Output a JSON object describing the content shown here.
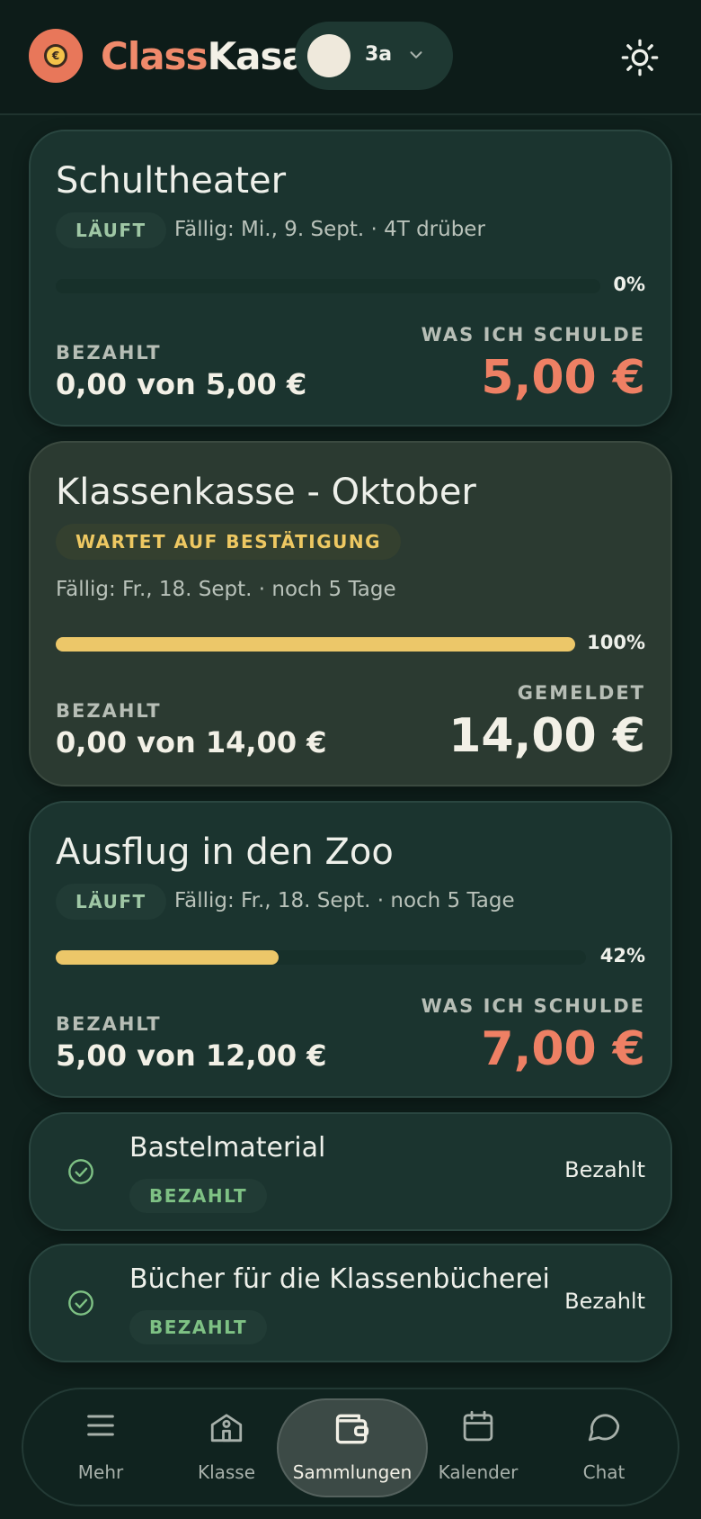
{
  "header": {
    "brand_part1": "Class",
    "brand_part2": "Kasa",
    "class_name": "3a"
  },
  "collections": [
    {
      "title": "Schultheater",
      "status": "LÄUFT",
      "due": "Fällig: Mi., 9. Sept. · 4T drüber",
      "progress_percent": 0,
      "progress_label": "0%",
      "paid_label": "BEZAHLT",
      "paid_value": "0,00 von 5,00 €",
      "amount_label": "WAS ICH SCHULDE",
      "amount_value": "5,00 €"
    },
    {
      "title": "Klassenkasse - Oktober",
      "status": "WARTET AUF BESTÄTIGUNG",
      "due": "Fällig: Fr., 18. Sept. · noch 5 Tage",
      "progress_percent": 100,
      "progress_label": "100%",
      "paid_label": "BEZAHLT",
      "paid_value": "0,00 von 14,00 €",
      "amount_label": "GEMELDET",
      "amount_value": "14,00 €"
    },
    {
      "title": "Ausflug in den Zoo",
      "status": "LÄUFT",
      "due": "Fällig: Fr., 18. Sept. · noch 5 Tage",
      "progress_percent": 42,
      "progress_label": "42%",
      "paid_label": "BEZAHLT",
      "paid_value": "5,00 von 12,00 €",
      "amount_label": "WAS ICH SCHULDE",
      "amount_value": "7,00 €"
    }
  ],
  "paid_collections": [
    {
      "title": "Bastelmaterial",
      "badge": "BEZAHLT",
      "status": "Bezahlt"
    },
    {
      "title": "Bücher für die Klassenbücherei",
      "badge": "BEZAHLT",
      "status": "Bezahlt"
    }
  ],
  "nav": {
    "items": [
      {
        "label": "Mehr",
        "icon": "menu-icon"
      },
      {
        "label": "Klasse",
        "icon": "school-icon"
      },
      {
        "label": "Sammlungen",
        "icon": "wallet-icon",
        "active": true
      },
      {
        "label": "Kalender",
        "icon": "calendar-icon"
      },
      {
        "label": "Chat",
        "icon": "chat-icon"
      }
    ]
  },
  "colors": {
    "background": "#0f201c",
    "card": "#1b342f",
    "accent_owe": "#ee8064",
    "progress": "#ecc769",
    "paid_green": "#7ec184"
  }
}
